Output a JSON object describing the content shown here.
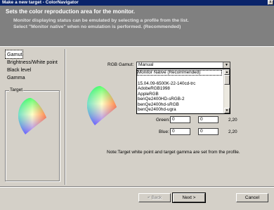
{
  "window": {
    "title": "Make a new target - ColorNavigator",
    "close_glyph": "x"
  },
  "banner": {
    "heading": "Sets the color reproduction area for the monitor.",
    "line1": "Monitor displaying status can be emulated by selecting a profile from the list.",
    "line2": "Select \"Monitor native\" when no emulation is performed. (Recommended)"
  },
  "nav": {
    "items": [
      "Gamut",
      "Brightness/White point",
      "Black level",
      "Gamma"
    ],
    "active": "Gamut"
  },
  "target_group": {
    "label": "Target"
  },
  "gamut": {
    "label": "RGB Gamut:",
    "selected": "Manual",
    "options": [
      "Monitor Native (Recommended)",
      "",
      "15.04.09-6500K-22-140cd-trc",
      "AdobeRGB1998",
      "AppleRGB",
      "benQe2400HD-sRGB-2",
      "benQe2400hd-sRGB",
      "benQe2400hd-ugra"
    ]
  },
  "green": {
    "label": "Green:",
    "x": "0",
    "y": "0",
    "gamma": "2,20"
  },
  "blue": {
    "label": "Blue:",
    "x": "0",
    "y": "0",
    "gamma": "2,20"
  },
  "note": "Note:Target white point and target gamma are set from the profile.",
  "buttons": {
    "back": "< Back",
    "next": "Next >",
    "cancel": "Cancel"
  },
  "icons": {
    "dropdown_arrow": "chevron-down-icon",
    "scroll_up": "arrow-up-icon",
    "scroll_down": "arrow-down-icon"
  },
  "colors": {
    "titlebar": "#0a246a",
    "banner": "#808080",
    "face": "#d4d0c8"
  }
}
